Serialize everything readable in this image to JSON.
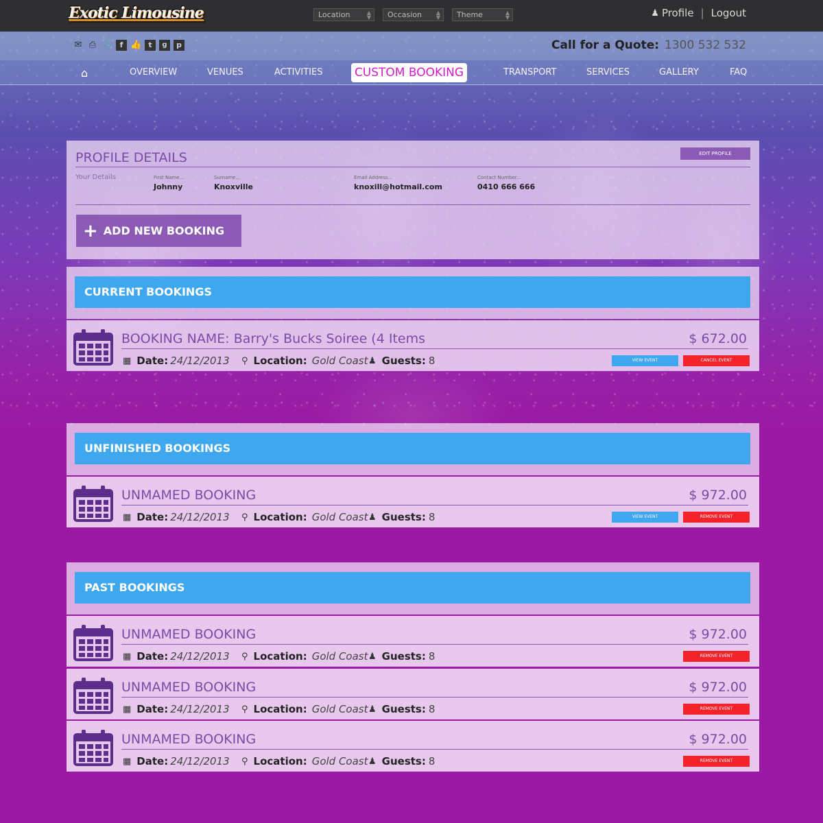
{
  "brand": {
    "logo": "Exotic Limousine"
  },
  "header": {
    "selects": [
      {
        "label": "Location"
      },
      {
        "label": "Occasion"
      },
      {
        "label": "Theme"
      }
    ],
    "profile_label": "Profile",
    "separator": "|",
    "logout_label": "Logout"
  },
  "utility": {
    "icons": [
      "mail-icon",
      "print-icon",
      "paperclip-icon",
      "facebook-icon",
      "thumbs-up-icon",
      "twitter-icon",
      "google-plus-icon",
      "pinterest-icon"
    ],
    "quote_label": "Call for a Quote:",
    "quote_number": "1300 532 532"
  },
  "nav": {
    "items": [
      "OVERVIEW",
      "VENUES",
      "ACTIVITIES",
      "CUSTOM BOOKING",
      "TRANSPORT",
      "SERVICES",
      "GALLERY",
      "FAQ"
    ],
    "active": "CUSTOM BOOKING"
  },
  "profile": {
    "title": "PROFILE DETAILS",
    "edit_label": "EDIT PROFILE",
    "your_details": "Your Details",
    "fields": [
      {
        "label": "First Name...",
        "value": "Johnny"
      },
      {
        "label": "Surname...",
        "value": "Knoxville"
      },
      {
        "label": "Email Address...",
        "value": "knoxill@hotmail.com"
      },
      {
        "label": "Contact Number...",
        "value": "0410 666 666"
      }
    ],
    "add_label": "ADD NEW BOOKING"
  },
  "labels": {
    "date": "Date:",
    "location": "Location:",
    "guests": "Guests:",
    "view": "VIEW EVENT",
    "cancel": "CANCEL EVENT",
    "remove": "REMOVE EVENT"
  },
  "sections": {
    "current": {
      "title": "CURRENT BOOKINGS",
      "bookings": [
        {
          "name": "BOOKING NAME: Barry's Bucks Soiree (4 Items",
          "price": "$ 672.00",
          "date": "24/12/2013",
          "location": "Gold Coast",
          "guests": "8"
        }
      ]
    },
    "unfinished": {
      "title": "UNFINISHED BOOKINGS",
      "bookings": [
        {
          "name": "UNMAMED BOOKING",
          "price": "$ 972.00",
          "date": "24/12/2013",
          "location": "Gold Coast",
          "guests": "8"
        }
      ]
    },
    "past": {
      "title": "PAST BOOKINGS",
      "bookings": [
        {
          "name": "UNMAMED BOOKING",
          "price": "$ 972.00",
          "date": "24/12/2013",
          "location": "Gold Coast",
          "guests": "8"
        },
        {
          "name": "UNMAMED BOOKING",
          "price": "$ 972.00",
          "date": "24/12/2013",
          "location": "Gold Coast",
          "guests": "8"
        },
        {
          "name": "UNMAMED BOOKING",
          "price": "$ 972.00",
          "date": "24/12/2013",
          "location": "Gold Coast",
          "guests": "8"
        }
      ]
    }
  },
  "colors": {
    "accent_blue": "#3fa7ee",
    "purple": "#8a5ab4",
    "danger": "#f4232b",
    "active_nav_text": "#d21ac8"
  }
}
